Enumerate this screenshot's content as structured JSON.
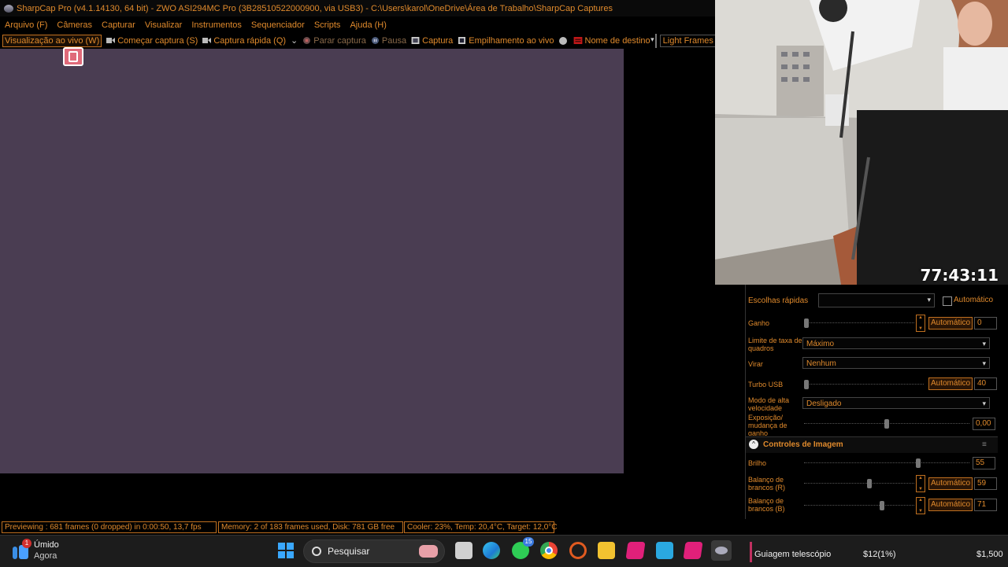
{
  "window": {
    "title": "SharpCap Pro (v4.1.14130, 64 bit) - ZWO ASI294MC Pro (3B28510522000900, via USB3) - C:\\Users\\karol\\OneDrive\\Área de Trabalho\\SharpCap Captures"
  },
  "menu": [
    "Arquivo (F)",
    "Câmeras",
    "Capturar",
    "Visualizar",
    "Instrumentos",
    "Sequenciador",
    "Scripts",
    "Ajuda (H)"
  ],
  "toolbar": {
    "live_view": "Visualização ao vivo (W)",
    "start_capture": "Começar captura (S)",
    "quick_capture": "Captura rápida (Q)",
    "stop_capture": "Parar captura",
    "pause": "Pausa",
    "snapshot": "Captura",
    "live_stack": "Empilhamento ao vivo",
    "target_name": "Nome de destino",
    "frame_type": "Light Frames"
  },
  "webcam": {
    "timer": "77:43:11"
  },
  "camera_controls": {
    "quick_picks_label": "Escolhas rápidas",
    "quick_picks_auto": "Automático",
    "gain_label": "Ganho",
    "gain_auto": "Automático",
    "gain_value": "0",
    "frame_rate_label": "Limite de taxa de quadros",
    "frame_rate_value": "Máximo",
    "flip_label": "Virar",
    "flip_value": "Nenhum",
    "usb_turbo_label": "Turbo USB",
    "usb_turbo_auto": "Automático",
    "usb_turbo_value": "40",
    "high_speed_label": "Modo de alta velocidade",
    "high_speed_value": "Desligado",
    "exposure_gain_label": "Exposição/ mudança de ganho",
    "exposure_gain_value": "0,00"
  },
  "image_controls": {
    "header": "Controles de Imagem",
    "brightness_label": "Brilho",
    "brightness_value": "55",
    "wb_red_label": "Balanço de brancos (R)",
    "wb_red_auto": "Automático",
    "wb_red_value": "59",
    "wb_blue_label": "Balanço de brancos (B)",
    "wb_blue_auto": "Automático",
    "wb_blue_value": "71"
  },
  "status": {
    "previewing": "Previewing : 681 frames (0 dropped) in 0:00:50, 13,7 fps",
    "memory": "Memory: 2 of 183 frames used, Disk: 781 GB free",
    "cooler": "Cooler: 23%, Temp: 20,4°C, Target: 12,0°C"
  },
  "taskbar": {
    "weather_title": "Úmido",
    "weather_sub": "Agora",
    "weather_badge": "1",
    "search_placeholder": "Pesquisar",
    "whatsapp_badge": "15",
    "overlay_left": "Guiagem telescópio",
    "overlay_mid": "$12(1%)",
    "overlay_right": "$1,500"
  }
}
